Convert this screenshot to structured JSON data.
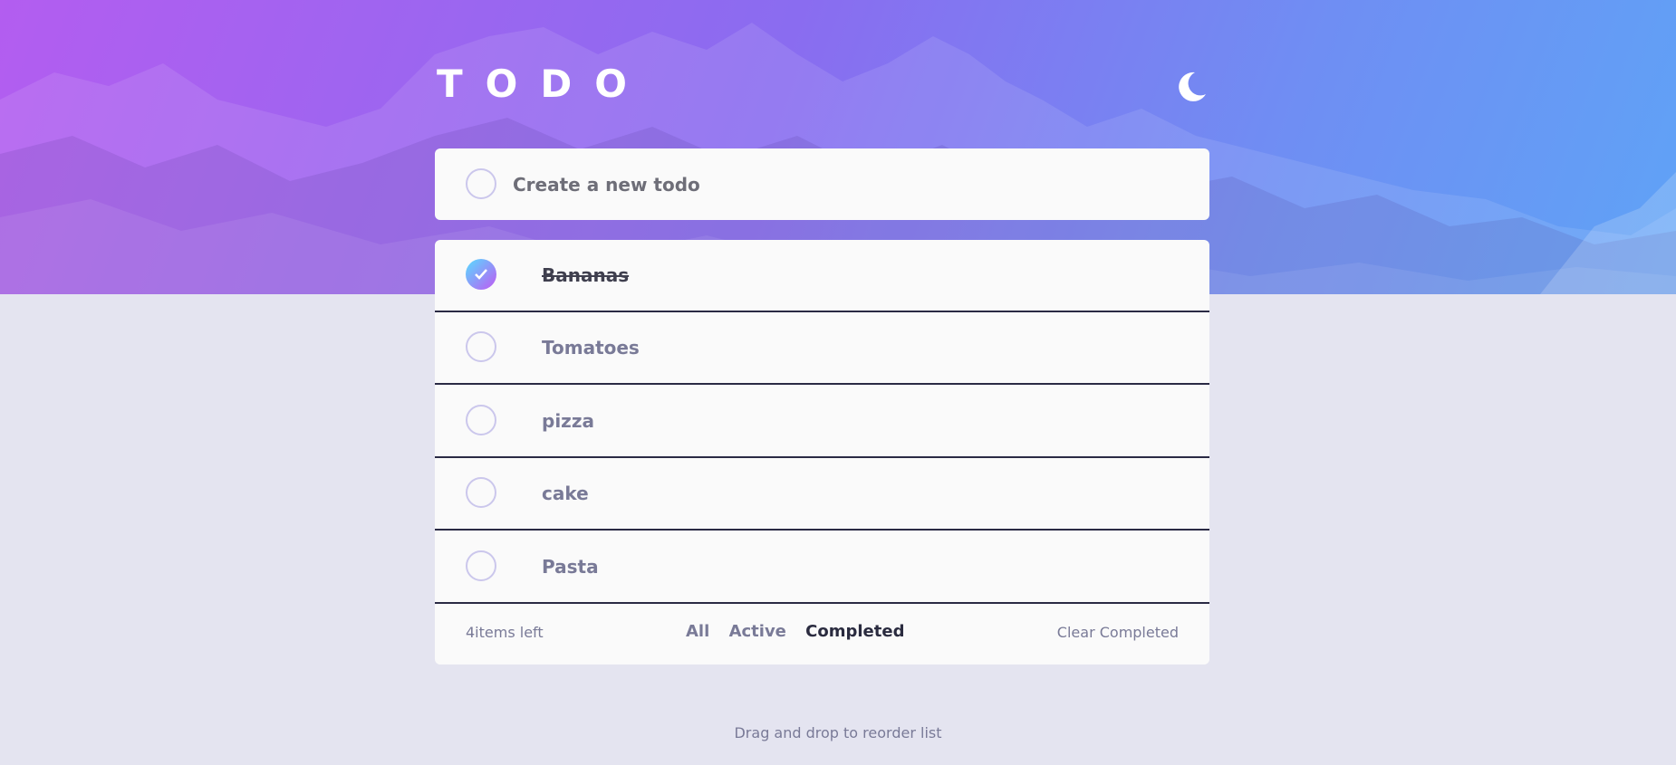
{
  "app": {
    "title": "TODO",
    "theme_icon": "moon-icon"
  },
  "new_todo": {
    "placeholder": "Create a new todo",
    "value": ""
  },
  "todos": [
    {
      "text": "Bananas",
      "completed": true
    },
    {
      "text": "Tomatoes",
      "completed": false
    },
    {
      "text": "pizza",
      "completed": false
    },
    {
      "text": "cake",
      "completed": false
    },
    {
      "text": "Pasta",
      "completed": false
    }
  ],
  "footer": {
    "items_left": "4items left",
    "filters": [
      {
        "label": "All",
        "active": false
      },
      {
        "label": "Active",
        "active": false
      },
      {
        "label": "Completed",
        "active": true
      }
    ],
    "clear_label": "Clear Completed"
  },
  "hint": "Drag and drop to reorder list",
  "colors": {
    "accent_gradient_start": "#57ddff",
    "accent_gradient_end": "#c058f3",
    "page_background": "#e4e4f0",
    "card_background": "#fafafa"
  }
}
